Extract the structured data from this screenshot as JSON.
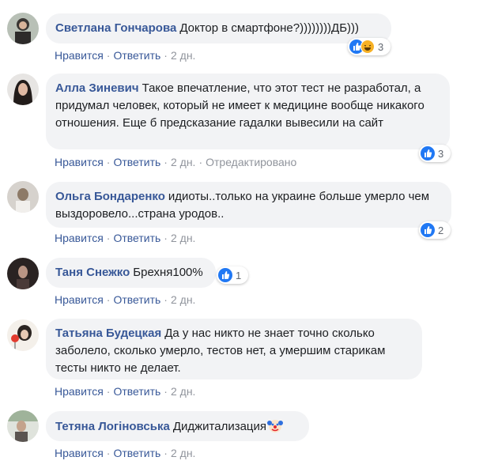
{
  "actions": {
    "like": "Нравится",
    "reply": "Ответить",
    "separator": "·"
  },
  "comments": [
    {
      "author": "Светлана Гончарова",
      "text": "Доктор в смартфоне?))))))))ДБ)))",
      "time": "2 дн.",
      "edited": "",
      "reactions": [
        "like-icon",
        "laugh-icon"
      ],
      "reaction_count": "3"
    },
    {
      "author": "Алла Зиневич",
      "text": "Такое впечатление, что этот тест не разработал, а придумал человек, который не имеет к медицине вообще никакого отношения. Еще б предсказание гадалки вывесили на сайт",
      "time": "2 дн.",
      "edited": "Отредактировано",
      "reactions": [
        "like-icon"
      ],
      "reaction_count": "3"
    },
    {
      "author": "Ольга Бондаренко",
      "text": "идиоты..только на украине больше умерло чем выздоровело...страна уродов..",
      "time": "2 дн.",
      "edited": "",
      "reactions": [
        "like-icon"
      ],
      "reaction_count": "2"
    },
    {
      "author": "Таня Снежко",
      "text": "Брехня100%",
      "time": "2 дн.",
      "edited": "",
      "reactions": [
        "like-icon"
      ],
      "reaction_count": "1"
    },
    {
      "author": "Татьяна Будецкая",
      "text": "Да у нас никто не знает точно сколько заболело, сколько умерло, тестов нет, а умершим старикам тесты никто не делает.",
      "time": "2 дн.",
      "edited": "",
      "reactions": [],
      "reaction_count": ""
    },
    {
      "author": "Тетяна Логіновська",
      "text": "Диджитализация",
      "time": "2 дн.",
      "edited": "",
      "trailing_icon": "clown-face-icon",
      "reactions": [],
      "reaction_count": ""
    }
  ],
  "colors": {
    "author": "#385898",
    "bubble": "#f2f3f5",
    "like_blue": "#2078f4",
    "meta_gray": "#90949c"
  }
}
